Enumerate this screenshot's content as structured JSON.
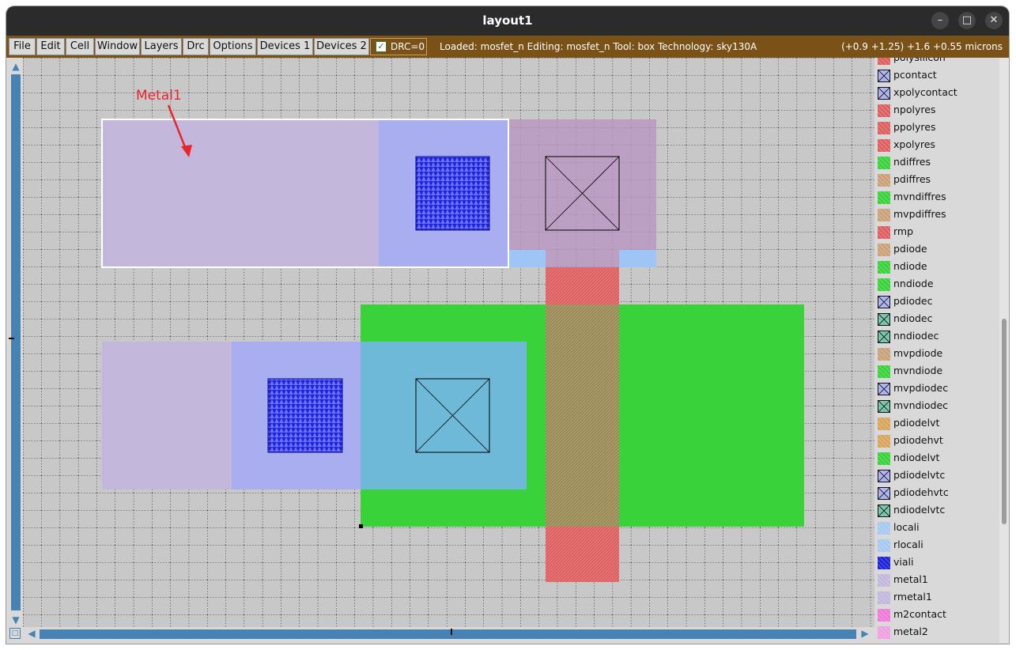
{
  "window": {
    "title": "layout1",
    "controls": {
      "minimize": "–",
      "maximize": "□",
      "close": "✕"
    }
  },
  "menubar": {
    "items": [
      "File",
      "Edit",
      "Cell",
      "Window",
      "Layers",
      "Drc",
      "Options",
      "Devices 1",
      "Devices 2"
    ],
    "drc_label": "DRC=0",
    "drc_checked": true,
    "status": "Loaded: mosfet_n Editing: mosfet_n Tool: box  Technology: sky130A",
    "coords": "(+0.9 +1.25) +1.6 +0.55 microns"
  },
  "canvas": {
    "annotation": "Metal1",
    "annotation_color": "#e8262d",
    "colors": {
      "background": "#c8c8c8",
      "metal1": "#c3b7dc",
      "local_interconnect": "#a8aef0",
      "via": "#1e24d8",
      "ndiff": "#3ad23a",
      "poly": "#de5f5f",
      "overlap": "#9a8a56"
    }
  },
  "palette": {
    "items": [
      {
        "label": "polysilicon",
        "icon": "poly-swatch",
        "color": "#de5f5f",
        "contact": false
      },
      {
        "label": "pcontact",
        "icon": "contact-swatch",
        "color": "#a8aef0",
        "contact": true
      },
      {
        "label": "xpolycontact",
        "icon": "contact-swatch",
        "color": "#a8aef0",
        "contact": true
      },
      {
        "label": "npolyres",
        "icon": "res-swatch",
        "color": "#de5f5f",
        "contact": false
      },
      {
        "label": "ppolyres",
        "icon": "res-swatch",
        "color": "#de5f5f",
        "contact": false
      },
      {
        "label": "xpolyres",
        "icon": "res-swatch",
        "color": "#de5f5f",
        "contact": false
      },
      {
        "label": "ndiffres",
        "icon": "diff-swatch",
        "color": "#3ad23a",
        "contact": false
      },
      {
        "label": "pdiffres",
        "icon": "diff-swatch",
        "color": "#c9a27a",
        "contact": false
      },
      {
        "label": "mvndiffres",
        "icon": "diff-swatch",
        "color": "#3ad23a",
        "contact": false
      },
      {
        "label": "mvpdiffres",
        "icon": "diff-swatch",
        "color": "#c9a27a",
        "contact": false
      },
      {
        "label": "rmp",
        "icon": "res-swatch",
        "color": "#de5f5f",
        "contact": false
      },
      {
        "label": "pdiode",
        "icon": "diode-swatch",
        "color": "#c9a27a",
        "contact": false
      },
      {
        "label": "ndiode",
        "icon": "diode-swatch",
        "color": "#3ad23a",
        "contact": false
      },
      {
        "label": "nndiode",
        "icon": "diode-swatch",
        "color": "#3ad23a",
        "contact": false
      },
      {
        "label": "pdiodec",
        "icon": "contact-swatch",
        "color": "#a8aef0",
        "contact": true
      },
      {
        "label": "ndiodec",
        "icon": "contact-swatch",
        "color": "#6fc2a4",
        "contact": true
      },
      {
        "label": "nndiodec",
        "icon": "contact-swatch",
        "color": "#6fc2a4",
        "contact": true
      },
      {
        "label": "mvpdiode",
        "icon": "diode-swatch",
        "color": "#c9a27a",
        "contact": false
      },
      {
        "label": "mvndiode",
        "icon": "diode-swatch",
        "color": "#3ad23a",
        "contact": false
      },
      {
        "label": "mvpdiodec",
        "icon": "contact-swatch",
        "color": "#a8aef0",
        "contact": true
      },
      {
        "label": "mvndiodec",
        "icon": "contact-swatch",
        "color": "#6fc2a4",
        "contact": true
      },
      {
        "label": "pdiodelvt",
        "icon": "diode-swatch",
        "color": "#d8a55e",
        "contact": false
      },
      {
        "label": "pdiodehvt",
        "icon": "diode-swatch",
        "color": "#d8a55e",
        "contact": false
      },
      {
        "label": "ndiodelvt",
        "icon": "diode-swatch",
        "color": "#3ad23a",
        "contact": false
      },
      {
        "label": "pdiodelvtc",
        "icon": "contact-swatch",
        "color": "#a8aef0",
        "contact": true
      },
      {
        "label": "pdiodehvtc",
        "icon": "contact-swatch",
        "color": "#a8aef0",
        "contact": true
      },
      {
        "label": "ndiodelvtc",
        "icon": "contact-swatch",
        "color": "#6fc2a4",
        "contact": true
      },
      {
        "label": "locali",
        "icon": "li-swatch",
        "color": "#a8c8f0",
        "contact": false
      },
      {
        "label": "rlocali",
        "icon": "li-swatch",
        "color": "#a8c8f0",
        "contact": false
      },
      {
        "label": "viali",
        "icon": "via-swatch",
        "color": "#1e24d8",
        "contact": false
      },
      {
        "label": "metal1",
        "icon": "metal-swatch",
        "color": "#c3b7dc",
        "contact": false
      },
      {
        "label": "rmetal1",
        "icon": "metal-swatch",
        "color": "#c3b7dc",
        "contact": false
      },
      {
        "label": "m2contact",
        "icon": "contact-swatch",
        "color": "#f07ad8",
        "contact": false
      },
      {
        "label": "metal2",
        "icon": "metal2-swatch",
        "color": "#f0a0e0",
        "contact": false
      }
    ]
  }
}
